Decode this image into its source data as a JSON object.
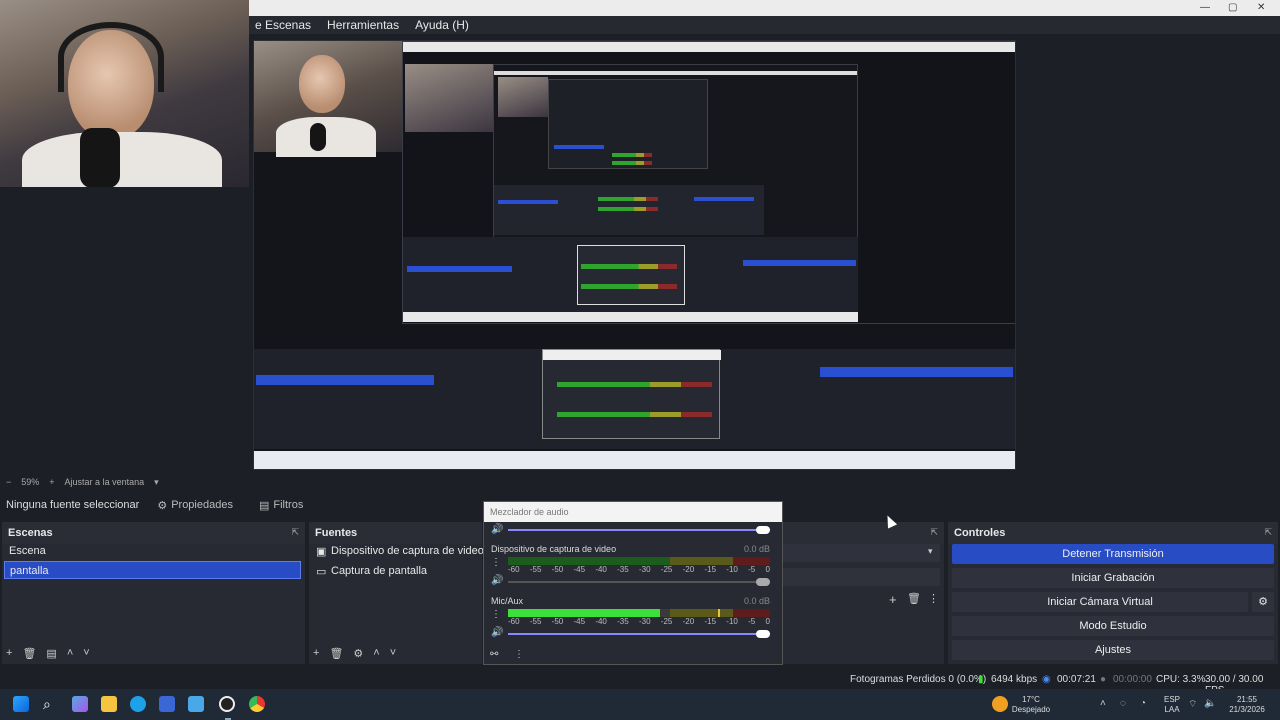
{
  "window": {
    "minimize": "—",
    "maximize": "▢",
    "close": "✕"
  },
  "menu": {
    "items": [
      "e Escenas",
      "Herramientas",
      "Ayuda (H)"
    ]
  },
  "zoom": {
    "level": "59%",
    "fit_label": "Ajustar a la ventana"
  },
  "source_toolbar": {
    "no_source": "Ninguna fuente seleccionar",
    "properties": "Propiedades",
    "filters": "Filtros"
  },
  "scenes": {
    "title": "Escenas",
    "items": [
      {
        "label": "Escena",
        "selected": false
      },
      {
        "label": "pantalla",
        "selected": true
      }
    ]
  },
  "sources": {
    "title": "Fuentes",
    "items": [
      {
        "label": "Dispositivo de captura de video",
        "icon": "camera-icon"
      },
      {
        "label": "Captura de pantalla",
        "icon": "monitor-icon"
      }
    ]
  },
  "mixer": {
    "title": "Mezclador de audio",
    "channels": [
      {
        "name": "Dispositivo de captura de video",
        "db": "0.0 dB",
        "level": 0.0
      },
      {
        "name": "Mic/Aux",
        "db": "0.0 dB",
        "level": 0.58
      }
    ],
    "ticks": [
      "-60",
      "-55",
      "-50",
      "-45",
      "-40",
      "-35",
      "-30",
      "-25",
      "-20",
      "-15",
      "-10",
      "-5",
      "0"
    ]
  },
  "controls": {
    "title": "Controles",
    "buttons": [
      {
        "label": "Detener Transmisión",
        "primary": true
      },
      {
        "label": "Iniciar Grabación",
        "primary": false
      },
      {
        "label": "Iniciar Cámara Virtual",
        "primary": false
      },
      {
        "label": "Modo Estudio",
        "primary": false
      },
      {
        "label": "Ajustes",
        "primary": false
      }
    ]
  },
  "status": {
    "frames_dropped": "Fotogramas Perdidos 0 (0.0%)",
    "bitrate": "6494 kbps",
    "stream_time": "00:07:21",
    "rec_time": "00:00:00",
    "cpu": "CPU: 3.3%",
    "fps": "30.00 / 30.00 FPS"
  },
  "tray": {
    "weather_temp": "17°C",
    "weather_text": "Despejado",
    "lang": "ESP",
    "lang2": "LAA",
    "time": "21:55",
    "date": "21/3/2026"
  },
  "colors": {
    "accent": "#284cc4",
    "panel": "#272a33",
    "bg": "#1d1f26"
  }
}
